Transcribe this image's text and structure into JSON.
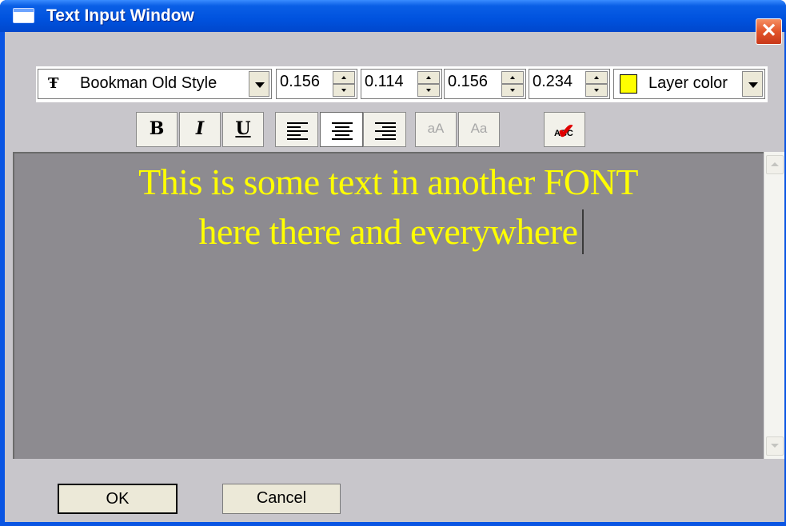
{
  "window": {
    "title": "Text Input Window",
    "close_label": "✕"
  },
  "toolbar": {
    "font_icon": "Ŧ",
    "font_name": "Bookman Old Style",
    "spinners": [
      {
        "value": "0.156"
      },
      {
        "value": "0.114"
      },
      {
        "value": "0.156"
      },
      {
        "value": "0.234"
      }
    ],
    "color_label": "Layer color",
    "color_value": "#ffff00",
    "bold_label": "B",
    "italic_label": "I",
    "underline_label": "U",
    "lowercase_label": "aA",
    "titlecase_label": "Aa",
    "spell_label": "ABC",
    "spell_check_glyph": "✔"
  },
  "editor": {
    "lines": [
      "This is some text in another FONT",
      "here there and everywhere"
    ],
    "background": "#8d8b90",
    "text_color": "#ffff00"
  },
  "buttons": {
    "ok": "OK",
    "cancel": "Cancel"
  }
}
